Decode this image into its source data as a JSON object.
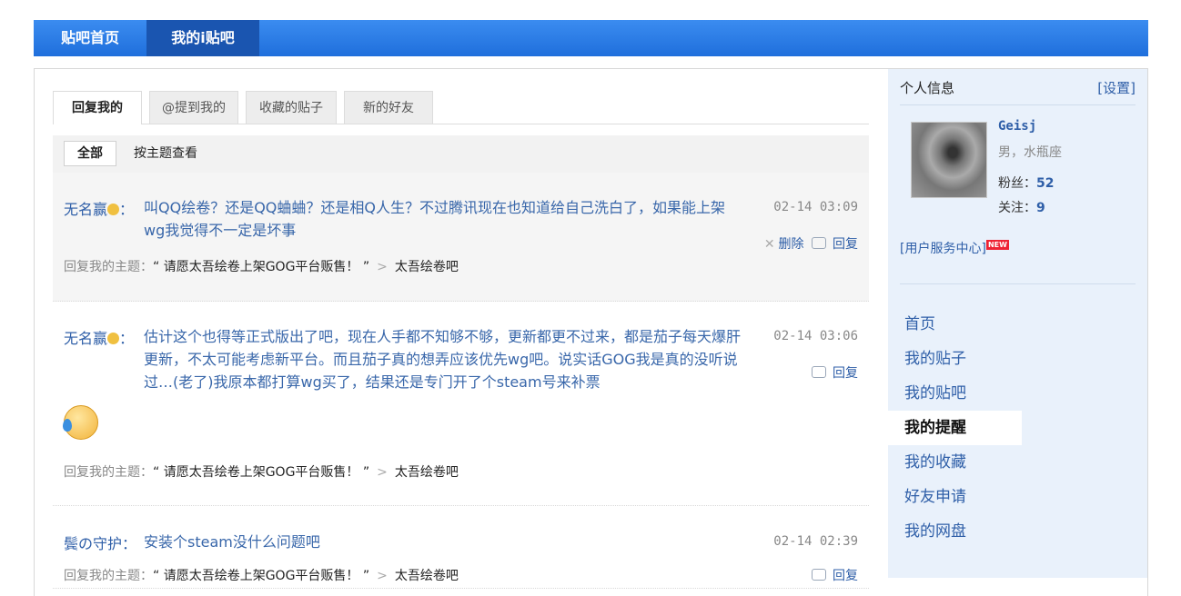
{
  "topnav": {
    "home": "贴吧首页",
    "mine": "我的i贴吧"
  },
  "tabs": [
    "回复我的",
    "@提到我的",
    "收藏的贴子",
    "新的好友"
  ],
  "filter": {
    "all": "全部",
    "by_topic": "按主题查看"
  },
  "posts": [
    {
      "author": "无名赢",
      "colon": "：",
      "text": "叫QQ绘卷？还是QQ蛐蛐？还是相Q人生？不过腾讯现在也知道给自己洗白了，如果能上架wg我觉得不一定是坏事",
      "time": "02-14 03:09",
      "delete": "删除",
      "reply": "回复",
      "topic_prefix": "回复我的主题：",
      "topic": "“ 请愿太吾绘卷上架GOG平台贩售！ ”",
      "forum": "太吾绘卷吧"
    },
    {
      "author": "无名赢",
      "colon": "：",
      "text": "估计这个也得等正式版出了吧，现在人手都不知够不够，更新都更不过来，都是茄子每天爆肝更新，不太可能考虑新平台。而且茄子真的想弄应该优先wg吧。说实话GOG我是真的没听说过…(老了)我原本都打算wg买了，结果还是专门开了个steam号来补票",
      "time": "02-14 03:06",
      "reply": "回复",
      "topic_prefix": "回复我的主题：",
      "topic": "“ 请愿太吾绘卷上架GOG平台贩售！ ”",
      "forum": "太吾绘卷吧"
    },
    {
      "author": "鬓の守护",
      "colon": "：",
      "text": "安装个steam没什么问题吧",
      "time": "02-14 02:39",
      "reply": "回复",
      "topic_prefix": "回复我的主题：",
      "topic": "“ 请愿太吾绘卷上架GOG平台贩售！ ”",
      "forum": "太吾绘卷吧"
    }
  ],
  "profile": {
    "title": "个人信息",
    "settings": "[设置]",
    "username": "Geisj",
    "info": "男，水瓶座",
    "fans_label": "粉丝：",
    "fans": "52",
    "follow_label": "关注：",
    "follow": "9",
    "service": "[用户服务中心]",
    "new_badge": "NEW"
  },
  "menu": [
    "首页",
    "我的贴子",
    "我的贴吧",
    "我的提醒",
    "我的收藏",
    "好友申请",
    "我的网盘"
  ],
  "menu_active": "我的提醒"
}
